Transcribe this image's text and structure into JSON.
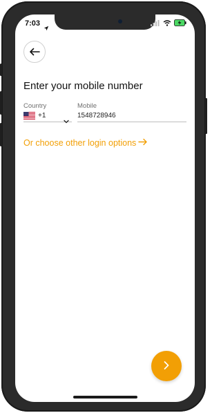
{
  "status_bar": {
    "time": "7:03",
    "icons": [
      "location-arrow-icon",
      "wifi-icon",
      "battery-charging-icon"
    ]
  },
  "header": {
    "back_icon": "arrow-left-icon"
  },
  "main": {
    "title": "Enter your mobile number",
    "country": {
      "label": "Country",
      "code": "+1",
      "flag_icon": "us-flag-icon"
    },
    "mobile": {
      "label": "Mobile",
      "value": "1548728946"
    },
    "other_login_text": "Or choose other login options"
  },
  "colors": {
    "accent": "#f29f05",
    "text": "#111111",
    "muted": "#6f6f6f"
  }
}
